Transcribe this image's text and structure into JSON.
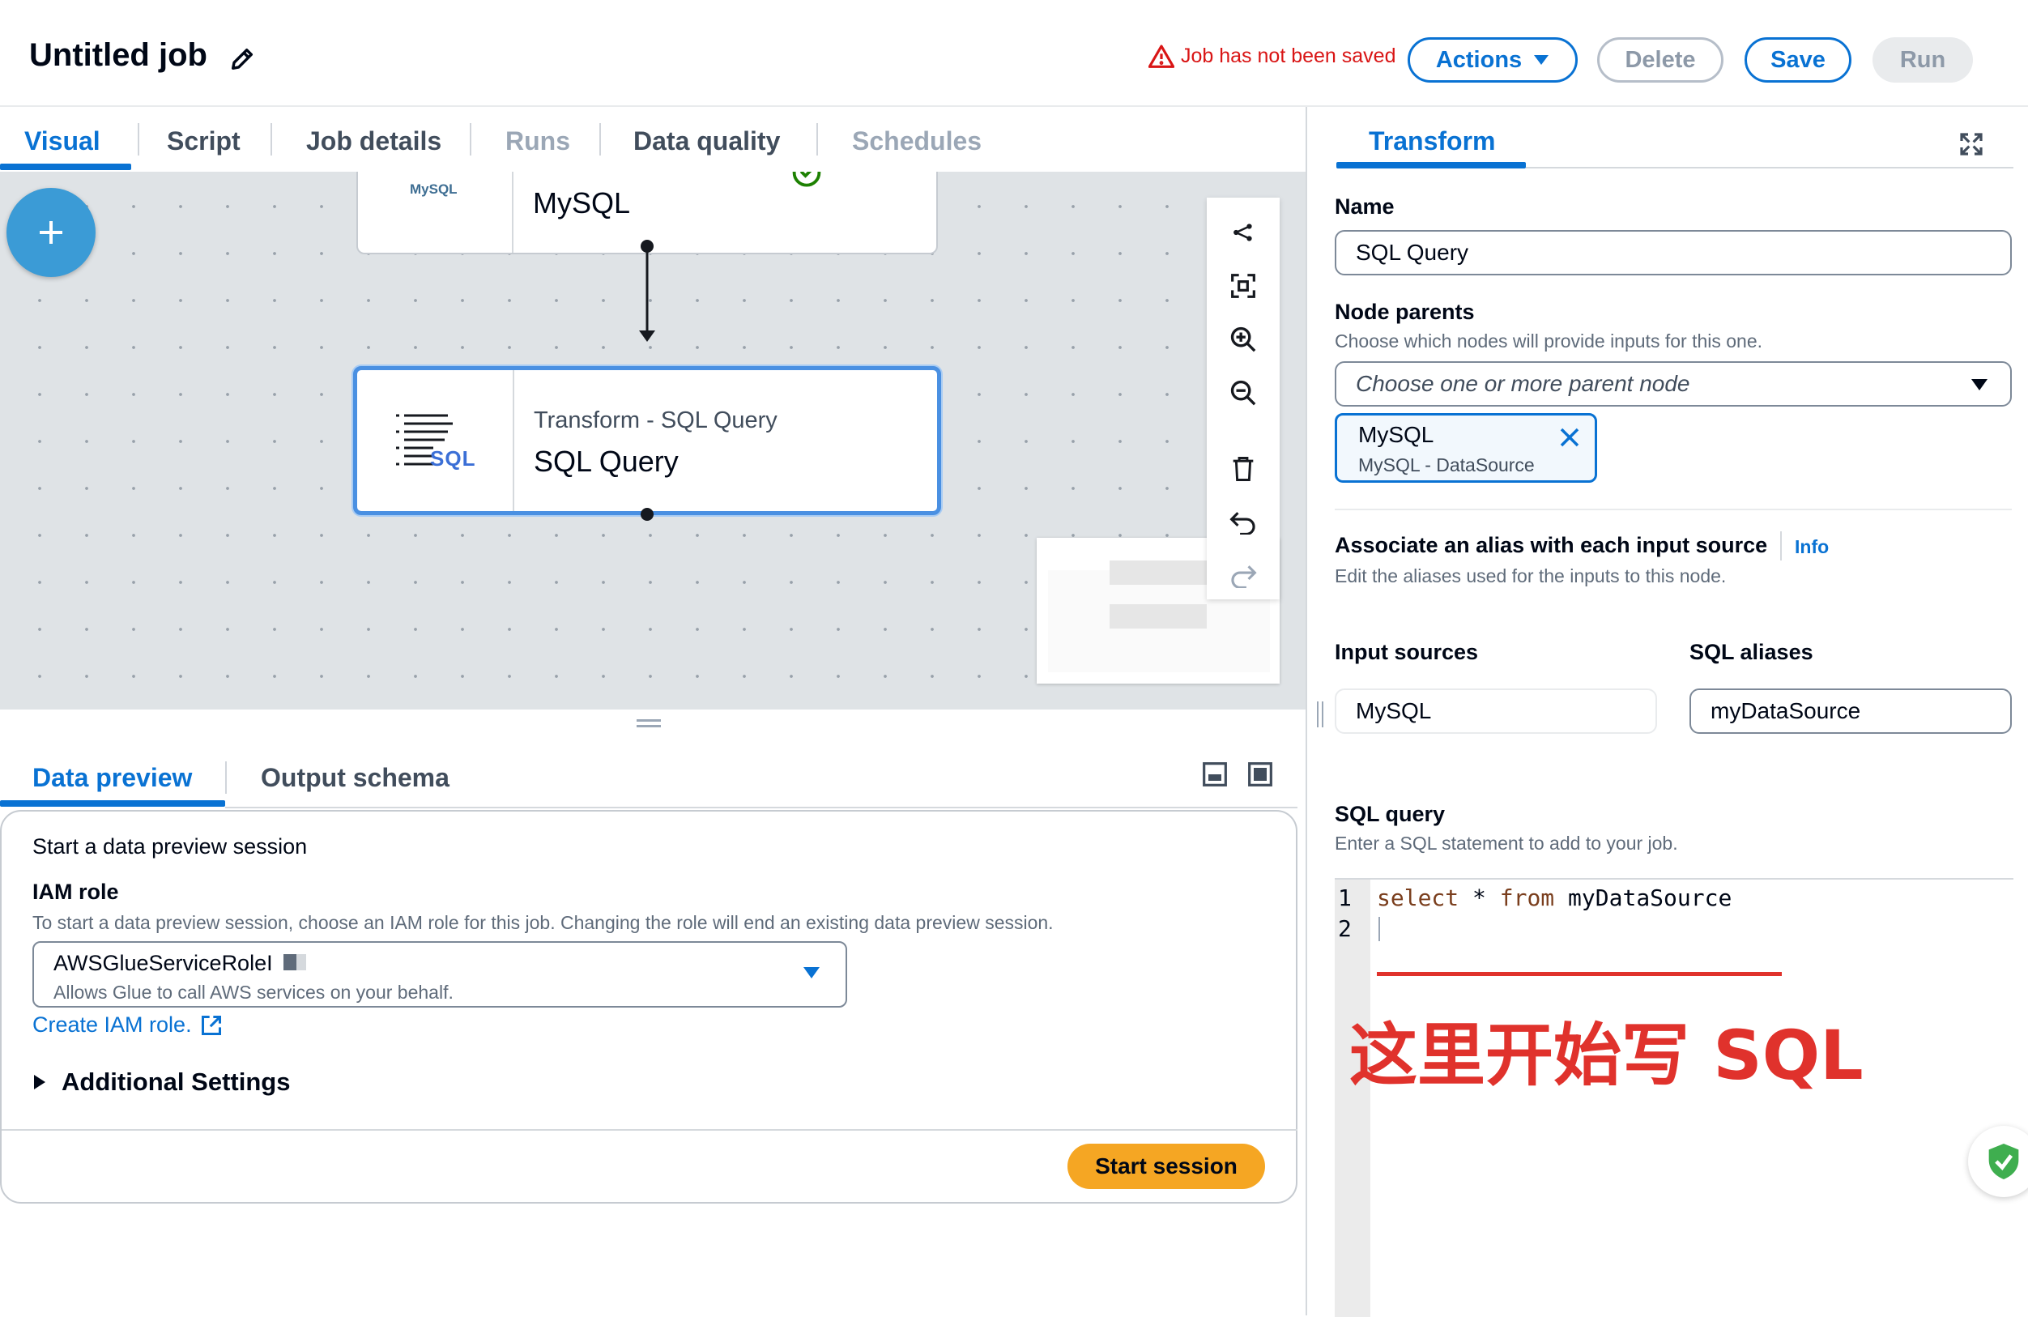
{
  "header": {
    "title": "Untitled job",
    "warning": "Job has not been saved",
    "actions_label": "Actions",
    "delete_label": "Delete",
    "save_label": "Save",
    "run_label": "Run"
  },
  "tabs": [
    {
      "label": "Visual",
      "state": "active"
    },
    {
      "label": "Script",
      "state": "enabled"
    },
    {
      "label": "Job details",
      "state": "enabled"
    },
    {
      "label": "Runs",
      "state": "disabled"
    },
    {
      "label": "Data quality",
      "state": "enabled"
    },
    {
      "label": "Schedules",
      "state": "disabled"
    }
  ],
  "canvas": {
    "source_node": {
      "logo_text": "MySQL",
      "title": "MySQL",
      "status": "check-circle-icon"
    },
    "transform_node": {
      "type_label": "Transform - SQL Query",
      "title": "SQL Query",
      "icon_text": "SQL"
    },
    "toolbar": [
      "layout-icon",
      "fit-view-icon",
      "zoom-in-icon",
      "zoom-out-icon",
      "delete-icon",
      "undo-icon",
      "redo-icon"
    ]
  },
  "bottom": {
    "tabs": [
      {
        "label": "Data preview",
        "state": "active"
      },
      {
        "label": "Output schema",
        "state": "enabled"
      }
    ],
    "session_heading": "Start a data preview session",
    "iam_label": "IAM role",
    "iam_desc": "To start a data preview session, choose an IAM role for this job. Changing the role will end an existing data preview session.",
    "iam_value": "AWSGlueServiceRoleI",
    "iam_value_desc": "Allows Glue to call AWS services on your behalf.",
    "create_role_link": "Create IAM role.",
    "additional_settings": "Additional Settings",
    "start_session": "Start session"
  },
  "panel": {
    "tab": "Transform",
    "name_label": "Name",
    "name_value": "SQL Query",
    "node_parents_label": "Node parents",
    "node_parents_desc": "Choose which nodes will provide inputs for this one.",
    "parent_placeholder": "Choose one or more parent node",
    "token": {
      "title": "MySQL",
      "subtitle": "MySQL - DataSource"
    },
    "alias_label": "Associate an alias with each input source",
    "info_link": "Info",
    "alias_desc": "Edit the aliases used for the inputs to this node.",
    "input_sources_label": "Input sources",
    "sql_aliases_label": "SQL aliases",
    "input_source_value": "MySQL",
    "sql_alias_value": "myDataSource",
    "sql_query_label": "SQL query",
    "sql_query_desc": "Enter a SQL statement to add to your job.",
    "code": {
      "line_numbers": [
        "1",
        "2"
      ],
      "kw_select": "select",
      "star": "*",
      "kw_from": "from",
      "table": "myDataSource"
    },
    "annotation": "这里开始写 SQL"
  },
  "colors": {
    "accent": "#0972d3",
    "warning": "#d91515",
    "primary_button": "#f5a623",
    "annotation": "#e0322c"
  }
}
